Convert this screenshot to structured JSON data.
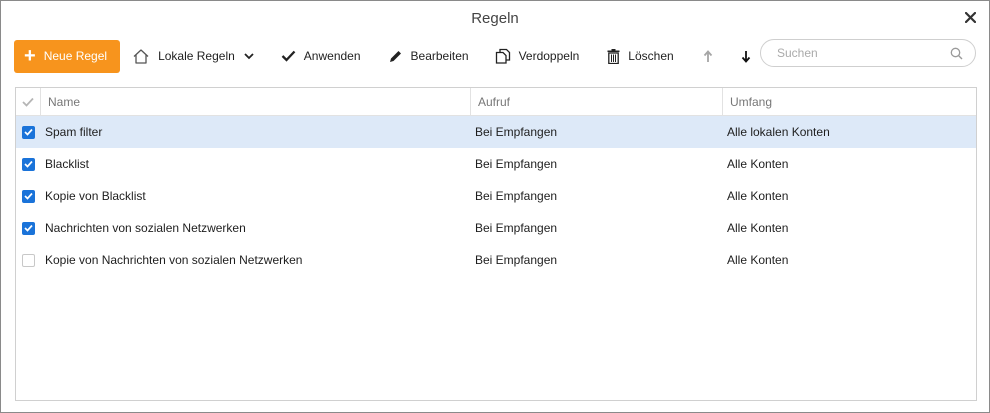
{
  "window": {
    "title": "Regeln"
  },
  "toolbar": {
    "new_rule": "Neue Regel",
    "local_rules": "Lokale Regeln",
    "apply": "Anwenden",
    "edit": "Bearbeiten",
    "duplicate": "Verdoppeln",
    "delete": "Löschen",
    "search_placeholder": "Suchen"
  },
  "colors": {
    "accent": "#f7941d",
    "checkbox": "#1a73d9",
    "selected_row": "#dde9f8"
  },
  "table": {
    "columns": [
      "Name",
      "Aufruf",
      "Umfang"
    ],
    "rows": [
      {
        "checked": true,
        "name": "Spam filter",
        "aufruf": "Bei Empfangen",
        "umfang": "Alle lokalen Konten",
        "selected": true
      },
      {
        "checked": true,
        "name": "Blacklist",
        "aufruf": "Bei Empfangen",
        "umfang": "Alle Konten",
        "selected": false
      },
      {
        "checked": true,
        "name": "Kopie von Blacklist",
        "aufruf": "Bei Empfangen",
        "umfang": "Alle Konten",
        "selected": false
      },
      {
        "checked": true,
        "name": "Nachrichten von sozialen Netzwerken",
        "aufruf": "Bei Empfangen",
        "umfang": "Alle Konten",
        "selected": false
      },
      {
        "checked": false,
        "name": "Kopie von Nachrichten von sozialen Netzwerken",
        "aufruf": "Bei Empfangen",
        "umfang": "Alle Konten",
        "selected": false
      }
    ]
  }
}
